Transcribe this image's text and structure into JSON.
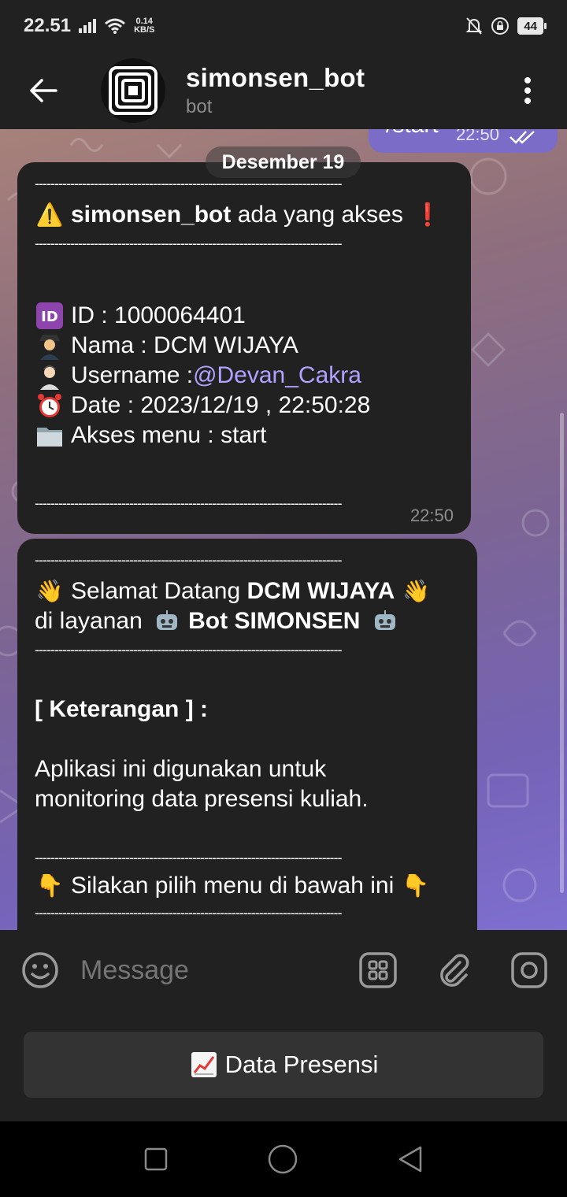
{
  "status_bar": {
    "time": "22.51",
    "net_speed_value": "0.14",
    "net_speed_unit": "KB/S",
    "battery": "44"
  },
  "header": {
    "title": "simonsen_bot",
    "subtitle": "bot"
  },
  "outgoing": {
    "text": "/start",
    "time": "22:50"
  },
  "date_pill": "Desember 19",
  "separator": "------------------------------------------------------------------------------",
  "msg1": {
    "alert_icon": "⚠️",
    "alert_name": "simonsen_bot",
    "alert_text": "ada yang akses",
    "alert_mark": "❗",
    "id_text": "ID : 1000064401",
    "nama_text": "Nama : DCM WIJAYA",
    "username_label": "Username : ",
    "username_link": "@Devan_Cakra",
    "date_text": "Date : 2023/12/19 , 22:50:28",
    "akses_text": "Akses menu : start",
    "time": "22:50"
  },
  "msg2": {
    "welcome_pre": "Selamat Datang",
    "welcome_name": "DCM WIJAYA",
    "layanan_pre": "di layanan",
    "layanan_bot": "Bot SIMONSEN",
    "keterangan": "[ Keterangan ] :",
    "desc1": "Aplikasi ini digunakan untuk",
    "desc2": "monitoring data presensi kuliah.",
    "pilih": "Silakan pilih menu di bawah ini"
  },
  "input": {
    "placeholder": "Message"
  },
  "keyboard": {
    "button_label": "Data Presensi"
  },
  "colors": {
    "panel": "#212121",
    "link": "#b3a1ff",
    "outgoing": "#7b6cc8"
  }
}
